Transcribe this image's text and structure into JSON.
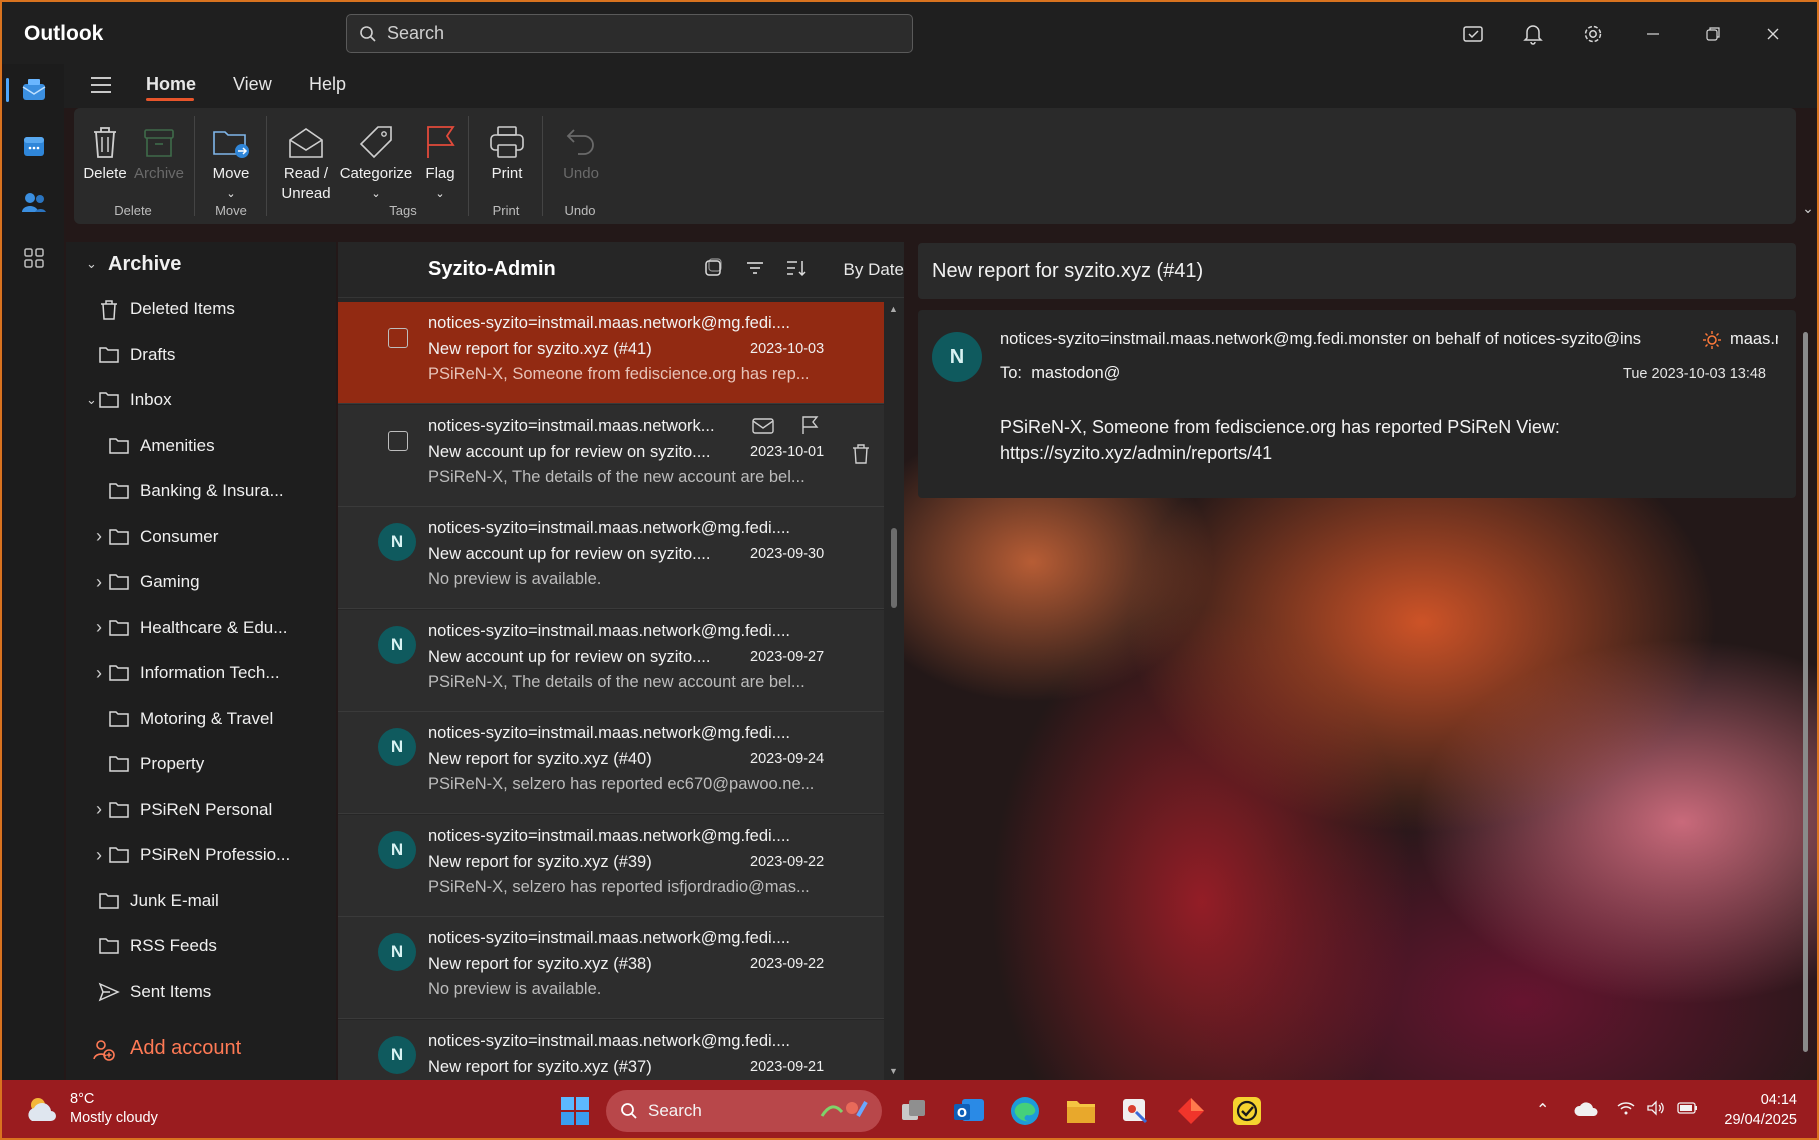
{
  "app": {
    "title": "Outlook"
  },
  "search": {
    "placeholder": "Search"
  },
  "titlebar_icons": [
    "tasks-icon",
    "bell-icon",
    "gear-icon",
    "minimize-icon",
    "restore-icon",
    "close-icon"
  ],
  "ribbon": {
    "tabs": [
      "Home",
      "View",
      "Help"
    ],
    "active_tab": "Home",
    "groups": {
      "delete": {
        "label": "Delete",
        "buttons": [
          "Delete",
          "Archive"
        ]
      },
      "move": {
        "label": "Move",
        "buttons": [
          "Move"
        ]
      },
      "tags": {
        "label": "Tags",
        "buttons": [
          "Read / Unread",
          "Categorize",
          "Flag"
        ]
      },
      "print": {
        "label": "Print",
        "buttons": [
          "Print"
        ]
      },
      "undo": {
        "label": "Undo",
        "buttons": [
          "Undo"
        ]
      }
    },
    "read_line1": "Read /",
    "read_line2": "Unread"
  },
  "folders": {
    "archive": "Archive",
    "items": [
      "Deleted Items",
      "Drafts",
      "Inbox",
      "Amenities",
      "Banking & Insura...",
      "Consumer",
      "Gaming",
      "Healthcare & Edu...",
      "Information Tech...",
      "Motoring & Travel",
      "Property",
      "PSiReN Personal",
      "PSiReN Professio...",
      "Junk E-mail",
      "RSS Feeds",
      "Sent Items"
    ],
    "add_account": "Add account"
  },
  "message_list": {
    "title": "Syzito-Admin",
    "sort_label": "By Date",
    "messages": [
      {
        "from": "notices-syzito=instmail.maas.network@mg.fedi....",
        "subject": "New report for syzito.xyz (#41)",
        "date": "2023-10-03",
        "preview": "PSiReN-X, Someone from fediscience.org has rep...",
        "avatar": ""
      },
      {
        "from": "notices-syzito=instmail.maas.network...",
        "subject": "New account up for review on syzito....",
        "date": "2023-10-01",
        "preview": "PSiReN-X, The details of the new account are bel...",
        "avatar": ""
      },
      {
        "from": "notices-syzito=instmail.maas.network@mg.fedi....",
        "subject": "New account up for review on syzito....",
        "date": "2023-09-30",
        "preview": "No preview is available.",
        "avatar": "N"
      },
      {
        "from": "notices-syzito=instmail.maas.network@mg.fedi....",
        "subject": "New account up for review on syzito....",
        "date": "2023-09-27",
        "preview": "PSiReN-X, The details of the new account are bel...",
        "avatar": "N"
      },
      {
        "from": "notices-syzito=instmail.maas.network@mg.fedi....",
        "subject": "New report for syzito.xyz (#40)",
        "date": "2023-09-24",
        "preview": "PSiReN-X, selzero has reported ec670@pawoo.ne...",
        "avatar": "N"
      },
      {
        "from": "notices-syzito=instmail.maas.network@mg.fedi....",
        "subject": "New report for syzito.xyz (#39)",
        "date": "2023-09-22",
        "preview": "PSiReN-X, selzero has reported isfjordradio@mas...",
        "avatar": "N"
      },
      {
        "from": "notices-syzito=instmail.maas.network@mg.fedi....",
        "subject": "New report for syzito.xyz (#38)",
        "date": "2023-09-22",
        "preview": "No preview is available.",
        "avatar": "N"
      },
      {
        "from": "notices-syzito=instmail.maas.network@mg.fedi....",
        "subject": "New report for syzito.xyz (#37)",
        "date": "2023-09-21",
        "preview": "",
        "avatar": "N"
      }
    ]
  },
  "reading_pane": {
    "title": "New report for syzito.xyz (#41)",
    "avatar": "N",
    "sender": "notices-syzito=instmail.maas.network@mg.fedi.monster on behalf of notices-syzito@ins",
    "sender_tail": "maas.r",
    "to_label": "To:",
    "to": "mastodon@",
    "date": "Tue 2023-10-03 13:48",
    "body_line1": "PSiReN-X, Someone from fediscience.org has reported PSiReN View:",
    "body_line2": "https://syzito.xyz/admin/reports/41"
  },
  "taskbar": {
    "temperature": "8°C",
    "weather": "Mostly cloudy",
    "search": "Search",
    "time": "04:14",
    "date": "29/04/2025"
  },
  "colors": {
    "accent": "#e8552b",
    "selected_row": "#922a12",
    "avatar": "#0f5a5e",
    "taskbar": "#9a1c1f"
  }
}
